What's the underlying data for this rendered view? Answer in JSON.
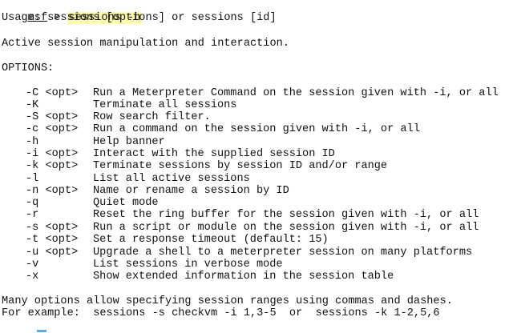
{
  "prompt": {
    "name": "msf",
    "symbol": " > ",
    "command": "sessions -h"
  },
  "usage": "Usage: sessions [options] or sessions [id]",
  "description": "Active session manipulation and interaction.",
  "options_header": "OPTIONS:",
  "options": [
    {
      "flag": "-C <opt>",
      "desc": "Run a Meterpreter Command on the session given with -i, or all"
    },
    {
      "flag": "-K",
      "desc": "Terminate all sessions"
    },
    {
      "flag": "-S <opt>",
      "desc": "Row search filter."
    },
    {
      "flag": "-c <opt>",
      "desc": "Run a command on the session given with -i, or all"
    },
    {
      "flag": "-h",
      "desc": "Help banner"
    },
    {
      "flag": "-i <opt>",
      "desc": "Interact with the supplied session ID"
    },
    {
      "flag": "-k <opt>",
      "desc": "Terminate sessions by session ID and/or range"
    },
    {
      "flag": "-l",
      "desc": "List all active sessions"
    },
    {
      "flag": "-n <opt>",
      "desc": "Name or rename a session by ID"
    },
    {
      "flag": "-q",
      "desc": "Quiet mode"
    },
    {
      "flag": "-r",
      "desc": "Reset the ring buffer for the session given with -i, or all"
    },
    {
      "flag": "-s <opt>",
      "desc": "Run a script or module on the session given with -i, or all"
    },
    {
      "flag": "-t <opt>",
      "desc": "Set a response timeout (default: 15)"
    },
    {
      "flag": "-u <opt>",
      "desc": "Upgrade a shell to a meterpreter session on many platforms"
    },
    {
      "flag": "-v",
      "desc": "List sessions in verbose mode"
    },
    {
      "flag": "-x",
      "desc": "Show extended information in the session table"
    }
  ],
  "footer": {
    "line1": "Many options allow specifying session ranges using commas and dashes.",
    "line2": "For example:  sessions -s checkvm -i 1,3-5  or  sessions -k 1-2,5,6"
  }
}
